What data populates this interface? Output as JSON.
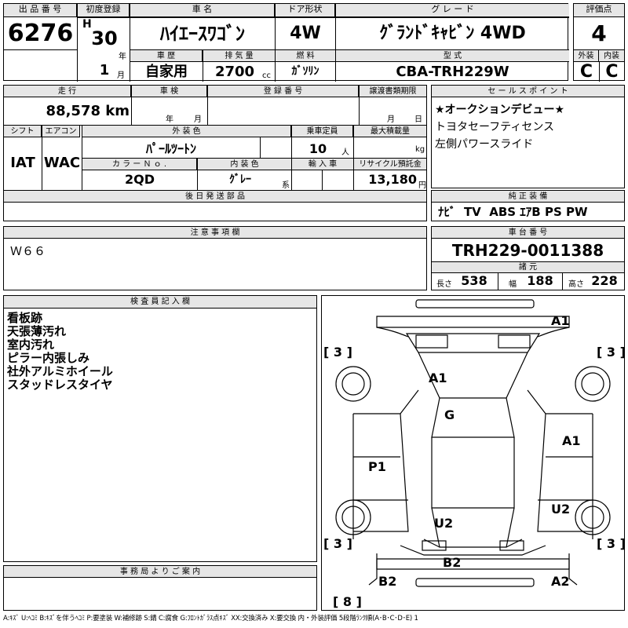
{
  "header": {
    "lot_no_label": "出 品 番 号",
    "lot_no": "6276",
    "first_reg_label": "初度登録",
    "era": "H",
    "year": "30",
    "year_unit": "年",
    "month": "1",
    "month_unit": "月",
    "car_name_label": "車 名",
    "car_name": "ﾊｲｴｰｽﾜｺﾞﾝ",
    "door_label": "ドア形状",
    "door": "4W",
    "grade_label": "グ レ ー ド",
    "grade": "ｸﾞﾗﾝﾄﾞｷｬﾋﾞﾝ 4WD",
    "score_label": "評価点",
    "score": "4",
    "history_label": "車 歴",
    "history": "自家用",
    "displacement_label": "排 気 量",
    "displacement": "2700",
    "displacement_unit": "cc",
    "fuel_label": "燃 料",
    "fuel": "ｶﾞｿﾘﾝ",
    "model_label": "型 式",
    "model": "CBA-TRH229W",
    "ext_label": "外装",
    "ext": "C",
    "int_label": "内装",
    "int": "C"
  },
  "row2": {
    "mileage_label": "走 行",
    "mileage": "88,578 km",
    "inspection_label": "車 検",
    "inspection_year": "年",
    "inspection_month": "月",
    "reg_no_label": "登 録 番 号",
    "transfer_label": "譲渡書類期限",
    "transfer_month": "月",
    "transfer_day": "日",
    "shift_label": "シフト",
    "shift": "IAT",
    "ac_label": "エアコン",
    "ac": "WAC",
    "ext_color_label": "外 装 色",
    "ext_color": "ﾊﾟｰﾙﾂｰﾄﾝ",
    "seats_label": "乗車定員",
    "seats": "10",
    "seats_unit": "人",
    "load_label": "最大積載量",
    "load_unit": "kg",
    "color_no_label": "カ ラ ー Ｎ ｏ .",
    "color_no": "2QD",
    "int_color_label": "内 装 色",
    "int_color": "ｸﾞﾚｰ",
    "int_color_unit": "系",
    "import_label": "輸 入 車",
    "recycle_label": "リサイクル預託金",
    "recycle": "13,180",
    "recycle_unit": "円",
    "later_parts_label": "後 日 発 送 部 品"
  },
  "sales": {
    "label": "セ ー ル ス ポ イ ン ト",
    "lines": [
      "★オークションデビュー★",
      "トヨタセーフティセンス",
      "左側パワースライド"
    ]
  },
  "equipment": {
    "label": "純 正 装 備",
    "value": "ﾅﾋﾞ  TV  ABS ｴｱB PS PW"
  },
  "caution": {
    "label": "注 意 事 項 欄",
    "value": "Ｗ６６"
  },
  "chassis": {
    "label": "車 台 番 号",
    "value": "TRH229-0011388",
    "dims_label": "諸 元",
    "length_label": "長さ",
    "length": "538",
    "width_label": "幅",
    "width": "188",
    "height_label": "高さ",
    "height": "228"
  },
  "inspector": {
    "label": "検 査 員 記 入 欄",
    "lines": [
      "看板跡",
      "天張薄汚れ",
      "室内汚れ",
      "ピラー内張しみ",
      "社外アルミホイール",
      "スタッドレスタイヤ"
    ]
  },
  "office": {
    "label": "事 務 局 よ り ご 案 内"
  },
  "diagram": {
    "marks": {
      "front_right": "A1",
      "roof": "A1",
      "center": "G",
      "right_side": "A1",
      "left_side": "P1",
      "rear_right": "U2",
      "rear_center": "U2",
      "tail": "B2",
      "rear_left_corner": "B2",
      "rear_right_corner": "A2"
    },
    "tires": {
      "front_left": "[ 3 ]",
      "front_right": "[ 3 ]",
      "rear_left": "[ 3 ]",
      "rear_right": "[ 3 ]",
      "spare": "[ 8 ]"
    }
  },
  "legend": "A:ｷｽﾞ U:ﾍｺﾐ B:ｷｽﾞを伴うﾍｺﾐ P:要塗装 W:補修跡 S:錆 C:腐食 G:ﾌﾛﾝﾄｶﾞﾗｽ点ｷｽﾞ XX:交換済み X:要交換  内・外装評価 5段階ﾗﾝｸ順(A･B･C･D･E) 1"
}
